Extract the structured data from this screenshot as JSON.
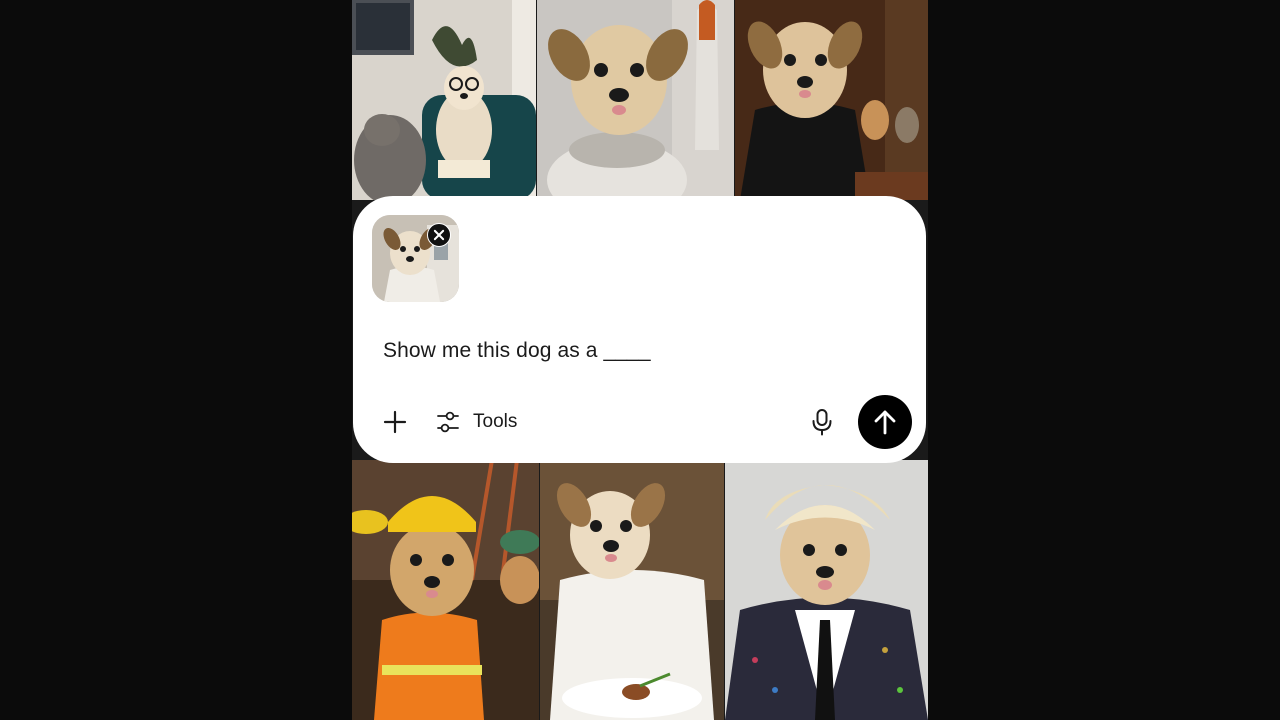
{
  "composer": {
    "prompt_text": "Show me this dog as a ____",
    "tools_label": "Tools"
  },
  "attachment": {
    "kind": "dog-photo",
    "removable": true
  },
  "gallery": {
    "top_row": [
      "dog-therapist-with-cat",
      "dog-astronaut-with-shuttle",
      "dog-judge-in-courtroom"
    ],
    "bottom_row": [
      "dog-construction-worker",
      "dog-chef-with-plate",
      "dog-rockstar-in-sequin-jacket"
    ]
  },
  "colors": {
    "page_background": "#0b0b0b",
    "composer_background": "#ffffff",
    "send_button": "#000000",
    "text": "#1b1b1b"
  },
  "icons": {
    "add": "plus-icon",
    "tools": "sliders-icon",
    "voice": "microphone-icon",
    "send": "arrow-up-icon",
    "remove_attachment": "close-icon"
  }
}
